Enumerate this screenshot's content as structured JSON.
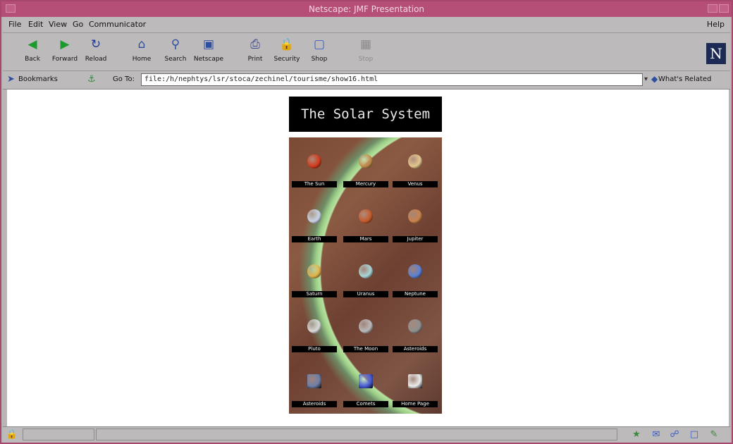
{
  "window": {
    "title": "Netscape: JMF Presentation"
  },
  "menu": {
    "file": "File",
    "edit": "Edit",
    "view": "View",
    "go": "Go",
    "communicator": "Communicator",
    "help": "Help"
  },
  "toolbar": {
    "back": "Back",
    "forward": "Forward",
    "reload": "Reload",
    "home": "Home",
    "search": "Search",
    "netscape": "Netscape",
    "print": "Print",
    "security": "Security",
    "shop": "Shop",
    "stop": "Stop"
  },
  "location": {
    "bookmarks": "Bookmarks",
    "goto_label": "Go To:",
    "url": "file:/h/nephtys/lsr/stoca/zechinel/tourisme/show16.html",
    "whats_related": "What's Related"
  },
  "page": {
    "banner": "The Solar System",
    "planets": [
      {
        "name": "The Sun",
        "color": "#d33a1c"
      },
      {
        "name": "Mercury",
        "color": "#c08b4a"
      },
      {
        "name": "Venus",
        "color": "#e3c68c"
      },
      {
        "name": "Earth",
        "color": "#c9d2e6"
      },
      {
        "name": "Mars",
        "color": "#c65a2b"
      },
      {
        "name": "Jupiter",
        "color": "#c9824c"
      },
      {
        "name": "Saturn",
        "color": "#e0b24b"
      },
      {
        "name": "Uranus",
        "color": "#a9d6d6"
      },
      {
        "name": "Neptune",
        "color": "#5b7fd4"
      },
      {
        "name": "Pluto",
        "color": "#d9d9d9"
      },
      {
        "name": "The Moon",
        "color": "#b9b9b9"
      },
      {
        "name": "Asteroids",
        "color": "#8f8f8f"
      },
      {
        "name": "Asteroids",
        "color": "#6e7fa8"
      },
      {
        "name": "Comets",
        "color": "#4a5ed8"
      },
      {
        "name": "Home Page",
        "color": "#ececec"
      }
    ]
  },
  "colors": {
    "titlebar": "#b54f78",
    "chrome": "#bdbabc"
  }
}
